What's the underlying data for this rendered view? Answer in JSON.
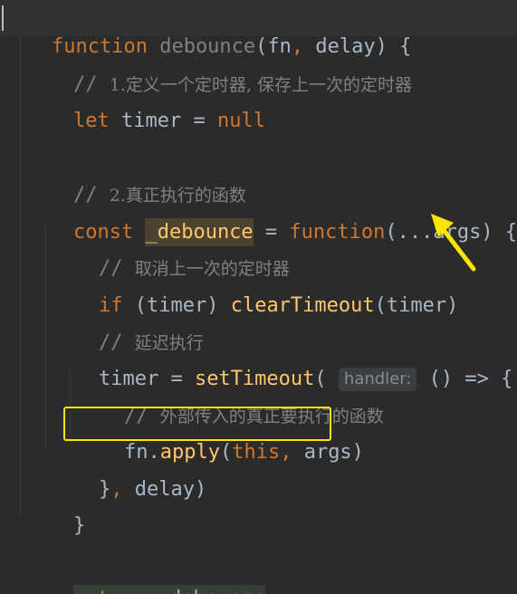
{
  "editor": {
    "line1": {
      "kw_function": "function",
      "name": "debounce",
      "params": "(fn",
      "comma": ",",
      "rest": " delay) {"
    },
    "line2": {
      "slash": "// ",
      "text": "1.定义一个定时器, 保存上一次的定时器"
    },
    "line3": {
      "kw_let": "let",
      "var": " timer = ",
      "kw_null": "null"
    },
    "line5": {
      "slash": "// ",
      "text": "2.真正执行的函数"
    },
    "line6": {
      "kw_const": "const",
      "sp": " ",
      "name": "_debounce",
      "eq": " = ",
      "kw_function": "function",
      "args": "(...args) {"
    },
    "line7": {
      "slash": "// ",
      "text": "取消上一次的定时器"
    },
    "line8": {
      "kw_if": "if",
      "cond": " (timer) ",
      "call": "clearTimeout",
      "arg": "(timer)"
    },
    "line9": {
      "slash": "// ",
      "text": "延迟执行"
    },
    "line10": {
      "lhs": "timer = ",
      "call": "setTimeout",
      "open": "(",
      "hint": "handler:",
      "arrow_fn": " () => {"
    },
    "line11": {
      "slash": "// ",
      "text": "外部传入的真正要执行的函数"
    },
    "line12": {
      "obj": "fn.",
      "method": "apply",
      "open": "(",
      "kw_this": "this",
      "comma": ",",
      "rest": " args)"
    },
    "line13": {
      "close": "}",
      "comma": ",",
      "rest": " delay)"
    },
    "line14": {
      "close": "}"
    },
    "line16": {
      "kw_return": "return",
      "sp": " ",
      "name": "_debounce"
    }
  },
  "annotations": {
    "box_color": "#ffe600",
    "arrow_color": "#ffe600",
    "arrow_icon": "yellow-arrow-icon"
  },
  "theme": {
    "background": "#2b2b2b",
    "keyword": "#cc7832",
    "function": "#ffc66d",
    "text": "#a9b7c6",
    "comment": "#808080"
  }
}
